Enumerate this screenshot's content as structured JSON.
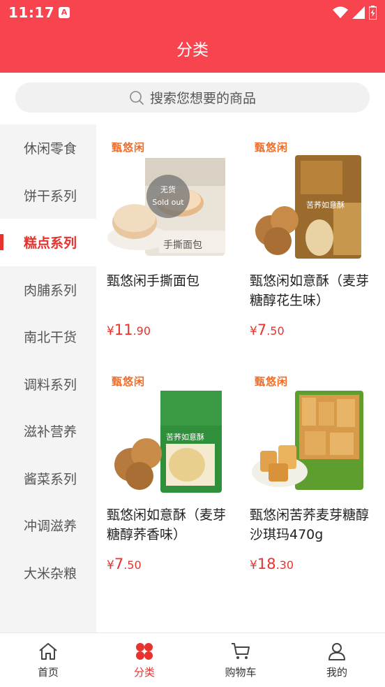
{
  "status_bar": {
    "time": "11:17",
    "app_badge": "A"
  },
  "header": {
    "title": "分类"
  },
  "search": {
    "placeholder": "搜索您想要的商品"
  },
  "sidebar": {
    "items": [
      {
        "label": "休闲零食",
        "active": false
      },
      {
        "label": "饼干系列",
        "active": false
      },
      {
        "label": "糕点系列",
        "active": true
      },
      {
        "label": "肉脯系列",
        "active": false
      },
      {
        "label": "南北干货",
        "active": false
      },
      {
        "label": "调料系列",
        "active": false
      },
      {
        "label": "滋补营养",
        "active": false
      },
      {
        "label": "酱菜系列",
        "active": false
      },
      {
        "label": "冲调滋养",
        "active": false
      },
      {
        "label": "大米杂粮",
        "active": false
      }
    ]
  },
  "products": [
    {
      "name": "甄悠闲手撕面包",
      "price_yen": "¥",
      "price_int": "11",
      "price_dec": ".90",
      "brand": "甄悠闲",
      "package_text": "手撕面包",
      "sold_out": true,
      "sold_out_text": "无货",
      "sold_out_sub": "Sold out"
    },
    {
      "name": "甄悠闲如意酥（麦芽糖醇花生味）",
      "price_yen": "¥",
      "price_int": "7",
      "price_dec": ".50",
      "brand": "甄悠闲",
      "package_text": "苦荞如意酥",
      "sold_out": false
    },
    {
      "name": "甄悠闲如意酥（麦芽糖醇荞香味）",
      "price_yen": "¥",
      "price_int": "7",
      "price_dec": ".50",
      "brand": "甄悠闲",
      "package_text": "苦荞如意酥",
      "sold_out": false
    },
    {
      "name": "甄悠闲苦荞麦芽糖醇沙琪玛470g",
      "price_yen": "¥",
      "price_int": "18",
      "price_dec": ".30",
      "brand": "甄悠闲",
      "package_text": "",
      "sold_out": false
    }
  ],
  "tabbar": {
    "tabs": [
      {
        "label": "首页",
        "icon": "home-icon",
        "active": false
      },
      {
        "label": "分类",
        "icon": "category-icon",
        "active": true
      },
      {
        "label": "购物车",
        "icon": "cart-icon",
        "active": false
      },
      {
        "label": "我的",
        "icon": "user-icon",
        "active": false
      }
    ]
  },
  "colors": {
    "primary": "#f7444e",
    "accent": "#e8322e",
    "brand_orange": "#ef6c26"
  }
}
